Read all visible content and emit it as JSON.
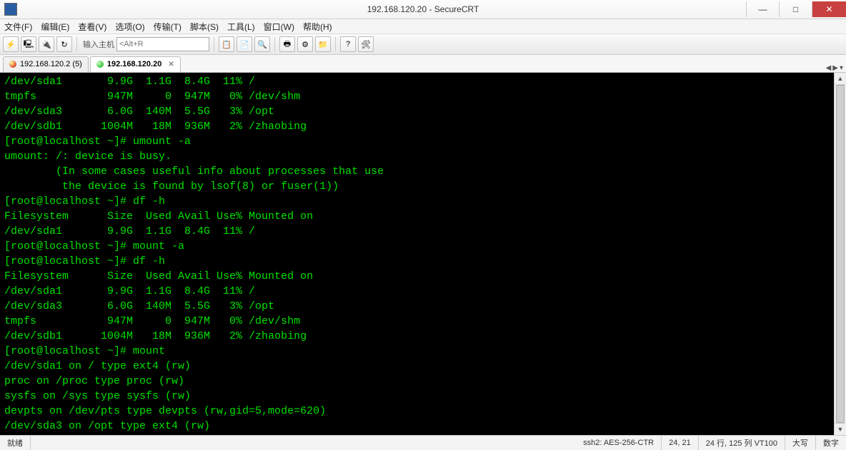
{
  "window": {
    "title": "192.168.120.20 - SecureCRT"
  },
  "menu": {
    "file": "文件(F)",
    "edit": "编辑(E)",
    "view": "查看(V)",
    "options": "选项(O)",
    "transfer": "传输(T)",
    "script": "脚本(S)",
    "tools": "工具(L)",
    "window": "窗口(W)",
    "help": "帮助(H)"
  },
  "toolbar": {
    "host_label": "输入主机",
    "host_placeholder": "<Alt+R"
  },
  "tabs": [
    {
      "label": "192.168.120.2 (5)",
      "status": "red",
      "active": false
    },
    {
      "label": "192.168.120.20",
      "status": "green",
      "active": true
    }
  ],
  "terminal_lines": [
    "/dev/sda1       9.9G  1.1G  8.4G  11% /",
    "tmpfs           947M     0  947M   0% /dev/shm",
    "/dev/sda3       6.0G  140M  5.5G   3% /opt",
    "/dev/sdb1      1004M   18M  936M   2% /zhaobing",
    "[root@localhost ~]# umount -a",
    "umount: /: device is busy.",
    "        (In some cases useful info about processes that use",
    "         the device is found by lsof(8) or fuser(1))",
    "[root@localhost ~]# df -h",
    "Filesystem      Size  Used Avail Use% Mounted on",
    "/dev/sda1       9.9G  1.1G  8.4G  11% /",
    "[root@localhost ~]# mount -a",
    "[root@localhost ~]# df -h",
    "Filesystem      Size  Used Avail Use% Mounted on",
    "/dev/sda1       9.9G  1.1G  8.4G  11% /",
    "/dev/sda3       6.0G  140M  5.5G   3% /opt",
    "tmpfs           947M     0  947M   0% /dev/shm",
    "/dev/sdb1      1004M   18M  936M   2% /zhaobing",
    "[root@localhost ~]# mount",
    "/dev/sda1 on / type ext4 (rw)",
    "proc on /proc type proc (rw)",
    "sysfs on /sys type sysfs (rw)",
    "devpts on /dev/pts type devpts (rw,gid=5,mode=620)",
    "/dev/sda3 on /opt type ext4 (rw)"
  ],
  "status": {
    "ready": "就绪",
    "proto": "ssh2: AES-256-CTR",
    "cursor": "24,  21",
    "size": "24 行, 125 列 VT100",
    "caps": "大写",
    "num": "数字"
  }
}
